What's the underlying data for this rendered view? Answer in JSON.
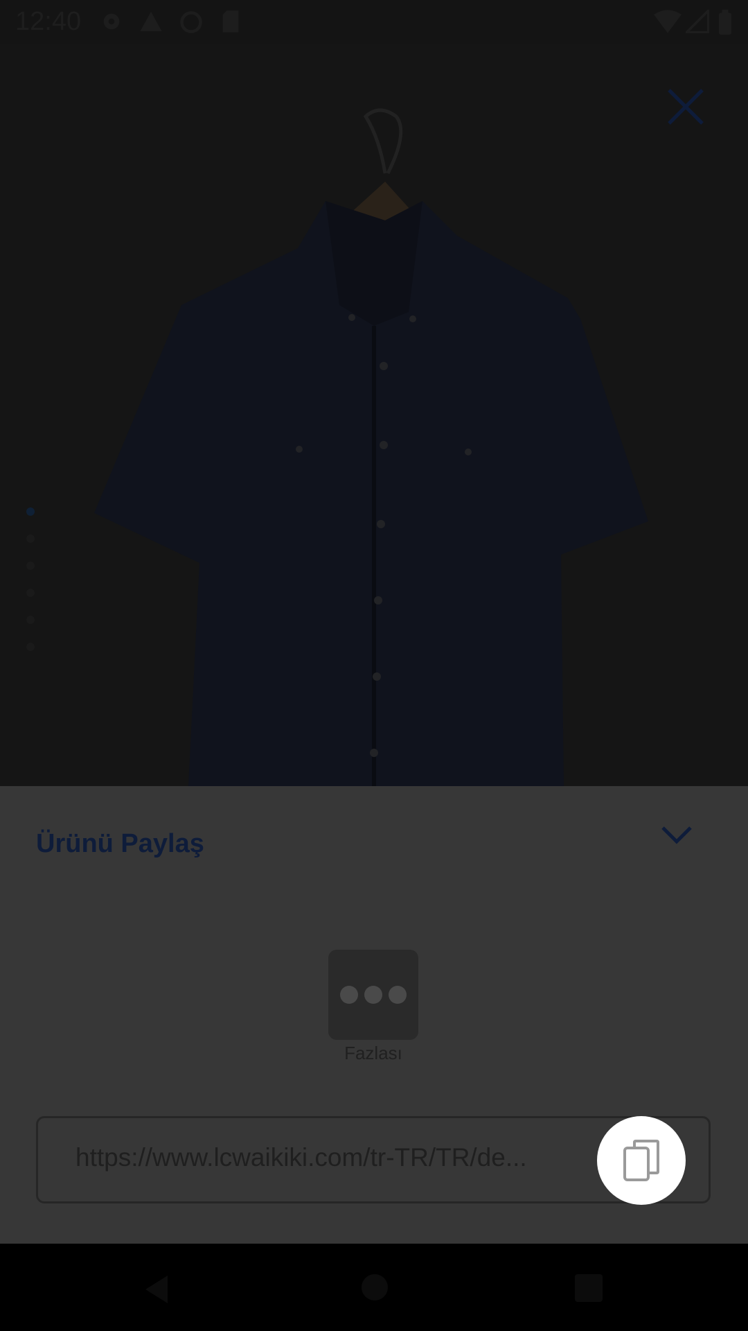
{
  "status_bar": {
    "time": "12:40",
    "left_icons": [
      "gear-icon",
      "warning-icon",
      "sync-icon",
      "sd-card-icon"
    ],
    "right_icons": [
      "wifi-icon",
      "signal-icon",
      "battery-icon"
    ]
  },
  "product_viewer": {
    "close_icon": "close-icon",
    "image_count": 6,
    "active_index": 0
  },
  "share_sheet": {
    "title": "Ürünü Paylaş",
    "collapse_icon": "chevron-down-icon",
    "apps": [
      {
        "label": "Fazlası",
        "icon": "more-icon"
      }
    ],
    "url": "https://www.lcwaikiki.com/tr-TR/TR/de...",
    "copy_icon": "copy-icon"
  },
  "colors": {
    "title": "#0e1c3a",
    "sheet_bg": "#373737",
    "scrim": "#151515"
  }
}
